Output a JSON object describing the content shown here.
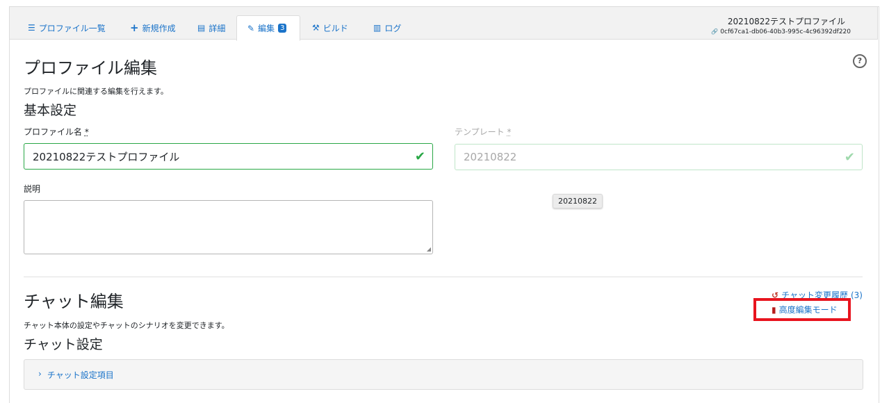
{
  "tabs": [
    {
      "icon": "☰",
      "label": "プロファイル一覧"
    },
    {
      "icon": "+",
      "label": "新規作成"
    },
    {
      "icon": "▤",
      "label": "詳細"
    },
    {
      "icon": "✎",
      "label": "編集",
      "badge": "3"
    },
    {
      "icon": "⚒",
      "label": "ビルド"
    },
    {
      "icon": "▥",
      "label": "ログ"
    }
  ],
  "header": {
    "profile_name": "20210822テストプロファイル",
    "profile_id_icon": "🔗",
    "profile_id": "0cf67ca1-db06-40b3-995c-4c96392df220"
  },
  "help_icon": "?",
  "page": {
    "title": "プロファイル編集",
    "description": "プロファイルに関連する編集を行えます。",
    "basic_settings": "基本設定"
  },
  "form": {
    "profile_name_label": "プロファイル名",
    "profile_name_value": "20210822テストプロファイル",
    "template_label": "テンプレート",
    "template_value": "20210822",
    "required_mark": "*",
    "description_label": "説明",
    "tooltip": "20210822",
    "check_glyph": "✔"
  },
  "chat": {
    "title": "チャット編集",
    "description": "チャット本体の設定やチャットのシナリオを変更できます。",
    "settings_title": "チャット設定",
    "history_link": "チャット変更履歴",
    "history_count": "(3)",
    "advanced_mode_link": "高度編集モード",
    "accordion_label": "チャット設定項目"
  },
  "colors": {
    "accent": "#1a73c9",
    "success": "#28a745",
    "highlight": "#e8141e"
  }
}
